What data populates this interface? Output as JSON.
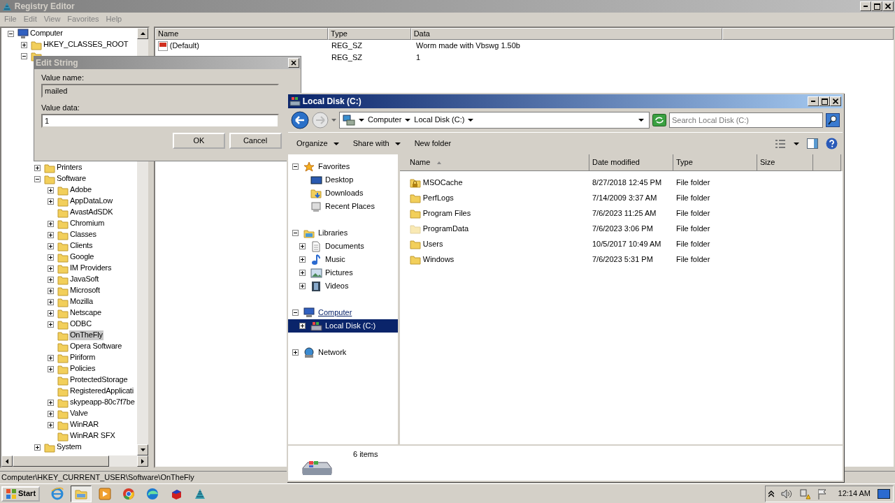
{
  "registry_window": {
    "title": "Registry Editor",
    "menu": [
      "File",
      "Edit",
      "View",
      "Favorites",
      "Help"
    ],
    "tree": [
      {
        "label": "Computer",
        "expanded": true,
        "selected": false,
        "children": [
          {
            "label": "HKEY_CLASSES_ROOT",
            "expanded": false,
            "selected": false
          },
          {
            "expanded": true,
            "children": [
              {
                "label": "Printers",
                "expanded": false,
                "selected": false
              },
              {
                "label": "Software",
                "expanded": true,
                "selected": false,
                "children": [
                  {
                    "label": "Adobe",
                    "expanded": false,
                    "selected": false
                  },
                  {
                    "label": "AppDataLow",
                    "expanded": false,
                    "selected": false
                  },
                  {
                    "label": "AvastAdSDK",
                    "selected": false
                  },
                  {
                    "label": "Chromium",
                    "expanded": false,
                    "selected": false
                  },
                  {
                    "label": "Classes",
                    "expanded": false,
                    "selected": false
                  },
                  {
                    "label": "Clients",
                    "expanded": false,
                    "selected": false
                  },
                  {
                    "label": "Google",
                    "expanded": false,
                    "selected": false
                  },
                  {
                    "label": "IM Providers",
                    "expanded": false,
                    "selected": false
                  },
                  {
                    "label": "JavaSoft",
                    "expanded": false,
                    "selected": false
                  },
                  {
                    "label": "Microsoft",
                    "expanded": false,
                    "selected": false
                  },
                  {
                    "label": "Mozilla",
                    "expanded": false,
                    "selected": false
                  },
                  {
                    "label": "Netscape",
                    "expanded": false,
                    "selected": false
                  },
                  {
                    "label": "ODBC",
                    "expanded": false,
                    "selected": false
                  },
                  {
                    "label": "OnTheFly",
                    "selected": true
                  },
                  {
                    "label": "Opera Software",
                    "selected": false
                  },
                  {
                    "label": "Piriform",
                    "expanded": false,
                    "selected": false
                  },
                  {
                    "label": "Policies",
                    "expanded": false,
                    "selected": false
                  },
                  {
                    "label": "ProtectedStorage",
                    "selected": false
                  },
                  {
                    "label": "RegisteredApplicati",
                    "selected": false
                  },
                  {
                    "label": "skypeapp-80c7f7be",
                    "expanded": false,
                    "selected": false
                  },
                  {
                    "label": "Valve",
                    "expanded": false,
                    "selected": false
                  },
                  {
                    "label": "WinRAR",
                    "expanded": false,
                    "selected": false
                  },
                  {
                    "label": "WinRAR SFX",
                    "selected": false
                  }
                ]
              },
              {
                "label": "System",
                "expanded": false,
                "selected": false
              }
            ]
          }
        ]
      }
    ],
    "columns": [
      "Name",
      "Type",
      "Data"
    ],
    "rows": [
      {
        "name": "(Default)",
        "type": "REG_SZ",
        "data": "Worm made with Vbswg 1.50b"
      },
      {
        "type": "REG_SZ",
        "data": "1"
      }
    ],
    "status_bar": "Computer\\HKEY_CURRENT_USER\\Software\\OnTheFly"
  },
  "edit_dialog": {
    "title": "Edit String",
    "value_name_label": "Value name:",
    "value_name": "mailed",
    "value_data_label": "Value data:",
    "value_data": "1",
    "buttons": [
      "OK",
      "Cancel"
    ]
  },
  "explorer": {
    "title": "Local Disk (C:)",
    "breadcrumb": [
      "Computer",
      "Local Disk (C:)"
    ],
    "search": {
      "placeholder": "Search Local Disk (C:)"
    },
    "toolbar": [
      {
        "label": "Organize",
        "dropdown": true
      },
      {
        "label": "Share with",
        "dropdown": true
      },
      {
        "label": "New folder",
        "dropdown": false
      }
    ],
    "nav": [
      {
        "label": "Favorites",
        "kind": "star",
        "expanded": true,
        "hovered": false,
        "selected": false,
        "children": [
          {
            "label": "Desktop",
            "kind": "desktop",
            "selected": false
          },
          {
            "label": "Downloads",
            "kind": "downloads",
            "selected": false
          },
          {
            "label": "Recent Places",
            "kind": "recent",
            "selected": false
          }
        ]
      },
      {
        "label": "Libraries",
        "kind": "library",
        "expanded": true,
        "hovered": false,
        "selected": false,
        "children": [
          {
            "label": "Documents",
            "kind": "document",
            "expanded": false,
            "selected": false
          },
          {
            "label": "Music",
            "kind": "music",
            "expanded": false,
            "selected": false
          },
          {
            "label": "Pictures",
            "kind": "pictures",
            "expanded": false,
            "selected": false
          },
          {
            "label": "Videos",
            "kind": "videos",
            "expanded": false,
            "selected": false
          }
        ]
      },
      {
        "label": "Computer",
        "kind": "computer",
        "expanded": true,
        "hovered": true,
        "selected": false,
        "children": [
          {
            "label": "Local Disk (C:)",
            "kind": "drive",
            "expanded": false,
            "selected": true
          }
        ]
      },
      {
        "label": "Network",
        "kind": "network",
        "expanded": false,
        "hovered": false,
        "selected": false
      }
    ],
    "columns": [
      {
        "label": "Name",
        "sorted": true
      },
      {
        "label": "Date modified",
        "sorted": false
      },
      {
        "label": "Type",
        "sorted": false
      },
      {
        "label": "Size",
        "sorted": false
      }
    ],
    "files": [
      {
        "name": "MSOCache",
        "date": "8/27/2018 12:45 PM",
        "type": "File folder",
        "locked": true,
        "hidden": false
      },
      {
        "name": "PerfLogs",
        "date": "7/14/2009 3:37 AM",
        "type": "File folder",
        "locked": false,
        "hidden": false
      },
      {
        "name": "Program Files",
        "date": "7/6/2023 11:25 AM",
        "type": "File folder",
        "locked": false,
        "hidden": false
      },
      {
        "name": "ProgramData",
        "date": "7/6/2023 3:06 PM",
        "type": "File folder",
        "locked": false,
        "hidden": true
      },
      {
        "name": "Users",
        "date": "10/5/2017 10:49 AM",
        "type": "File folder",
        "locked": false,
        "hidden": false
      },
      {
        "name": "Windows",
        "date": "7/6/2023 5:31 PM",
        "type": "File folder",
        "locked": false,
        "hidden": false
      }
    ],
    "item_count": "6 items"
  },
  "taskbar": {
    "start": "Start",
    "apps": [
      {
        "kind": "ie",
        "selected": false
      },
      {
        "kind": "folder",
        "selected": true
      },
      {
        "kind": "media",
        "selected": false
      },
      {
        "kind": "chrome",
        "selected": false
      },
      {
        "kind": "edge",
        "selected": false
      },
      {
        "kind": "app",
        "selected": false
      },
      {
        "kind": "registry",
        "selected": false
      }
    ],
    "clock": "12:14 AM"
  }
}
